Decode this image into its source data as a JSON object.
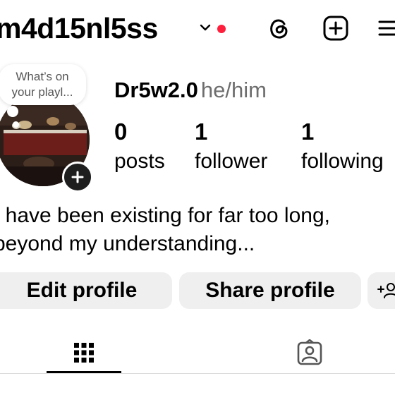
{
  "header": {
    "username": "m4d15nl5ss",
    "notification_dot_color": "#ff1f3d",
    "icons": [
      "chevron-down-icon",
      "threads-icon",
      "create-plus-icon",
      "menu-icon"
    ]
  },
  "note": {
    "text": "What’s on\nyour playl..."
  },
  "profile": {
    "display_name": "Dr5w2.0",
    "pronouns": "he/him",
    "stats": [
      {
        "value": "0",
        "label": "posts"
      },
      {
        "value": "1",
        "label": "follower"
      },
      {
        "value": "1",
        "label": "following"
      }
    ],
    "bio": "I have been existing for far too long,\nbeyond my understanding..."
  },
  "actions": {
    "edit_label": "Edit profile",
    "share_label": "Share profile"
  },
  "tabs": [
    {
      "icon": "grid-icon",
      "active": true
    },
    {
      "icon": "tagged-person-icon",
      "active": false
    }
  ]
}
